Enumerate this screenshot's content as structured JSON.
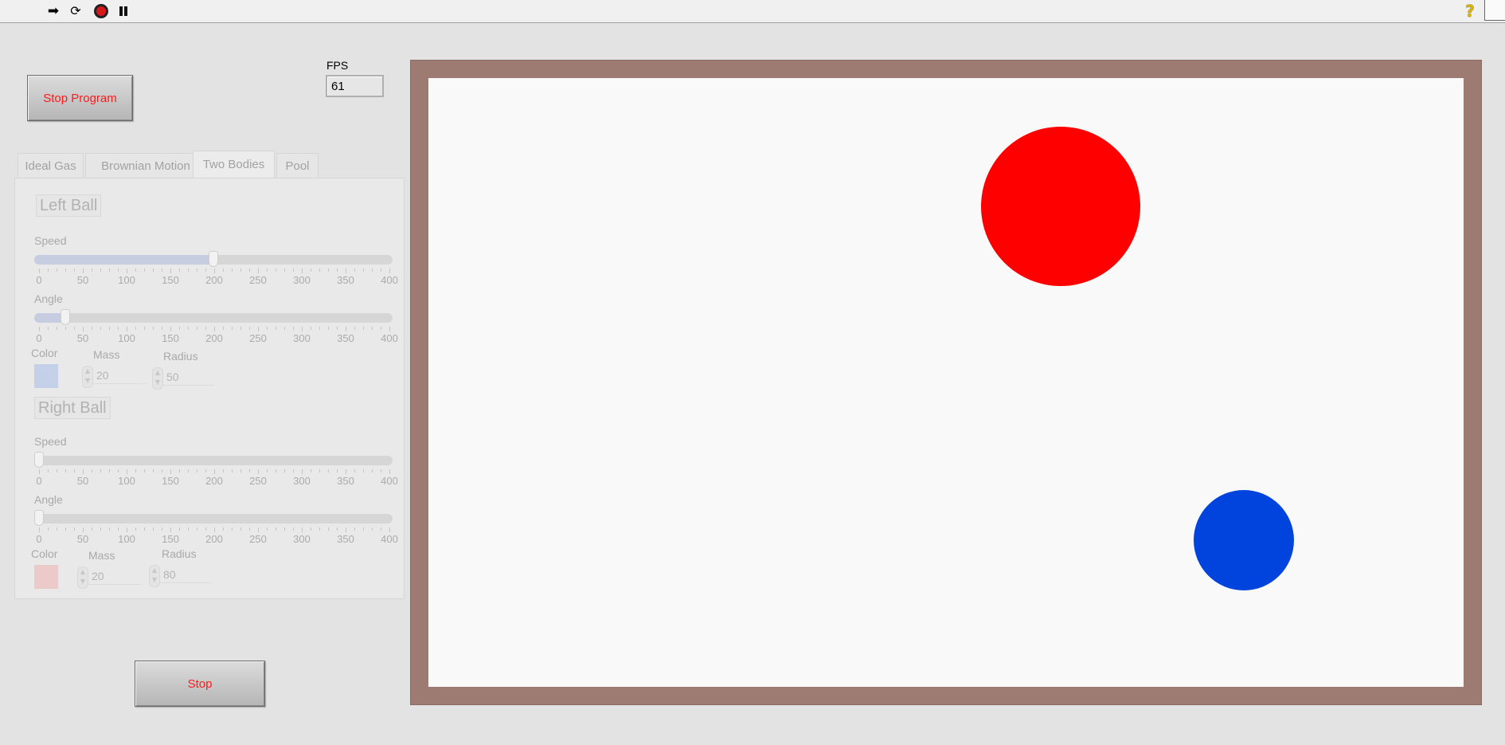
{
  "toolbar": {
    "icons": [
      "run-arrow-icon",
      "run-continuously-icon",
      "abort-execution-icon",
      "pause-icon",
      "help-icon"
    ],
    "run_glyph": "➡",
    "run_cont_glyph": "⟳",
    "help_glyph": "?"
  },
  "controls": {
    "stop_program_label": "Stop Program",
    "stop_label": "Stop",
    "fps_label": "FPS",
    "fps_value": "61"
  },
  "tabs": {
    "items": [
      "Ideal Gas",
      "Brownian Motion",
      "Two Bodies",
      "Pool"
    ],
    "active": "Two Bodies"
  },
  "left_ball": {
    "title": "Left Ball",
    "speed_label": "Speed",
    "speed_value": 200,
    "angle_label": "Angle",
    "angle_value": 30,
    "color_label": "Color",
    "color": "#c4cfe8",
    "mass_label": "Mass",
    "mass_value": "20",
    "radius_label": "Radius",
    "radius_value": "50"
  },
  "right_ball": {
    "title": "Right Ball",
    "speed_label": "Speed",
    "speed_value": 0,
    "angle_label": "Angle",
    "angle_value": 0,
    "color_label": "Color",
    "color": "#edcaca",
    "mass_label": "Mass",
    "mass_value": "20",
    "radius_label": "Radius",
    "radius_value": "80"
  },
  "slider_scale": {
    "min": 0,
    "max": 400,
    "labels": [
      "0",
      "50",
      "100",
      "150",
      "200",
      "250",
      "300",
      "350",
      "400"
    ]
  },
  "simulation": {
    "background": "#f9f9f9",
    "frame_color": "#9d7b73",
    "balls": [
      {
        "color": "#ff0000"
      },
      {
        "color": "#0044dd"
      }
    ]
  }
}
